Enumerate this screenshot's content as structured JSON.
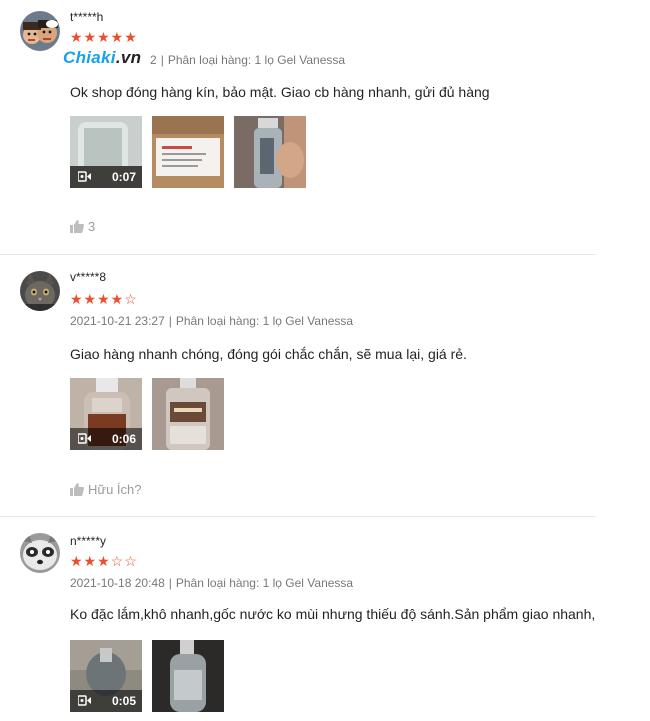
{
  "watermark": {
    "brand": "Chiaki",
    "suffix": ".vn"
  },
  "reviews": [
    {
      "username": "t*****h",
      "rating": 5,
      "stars": "★★★★★",
      "stars_empty": "",
      "date": "2",
      "variation": "Phân loại hàng: 1 lọ Gel Vanessa",
      "comment": "Ok shop đóng hàng kín, bảo mật.  Giao cb hàng nhanh, gửi đủ hàng",
      "media": [
        {
          "type": "video",
          "duration": "0:07"
        },
        {
          "type": "image"
        },
        {
          "type": "image"
        }
      ],
      "likes": "3"
    },
    {
      "username": "v*****8",
      "rating": 4,
      "stars": "★★★★",
      "stars_empty": "☆",
      "date": "2021-10-21 23:27",
      "variation": "Phân loại hàng: 1 lọ Gel Vanessa",
      "comment": "Giao hàng nhanh chóng, đóng gói chắc chắn, sẽ mua lại, giá rẻ.",
      "media": [
        {
          "type": "video",
          "duration": "0:06"
        },
        {
          "type": "image"
        }
      ],
      "likes": "Hữu Ích?"
    },
    {
      "username": "n*****y",
      "rating": 3,
      "stars": "★★★",
      "stars_empty": "☆☆",
      "date": "2021-10-18 20:48",
      "variation": "Phân loại hàng: 1 lọ Gel Vanessa",
      "comment": "Ko đặc lắm,khô nhanh,gốc nước ko mùi nhưng thiếu độ sánh.Sản phẩm giao nhanh,",
      "media": [
        {
          "type": "video",
          "duration": "0:05"
        },
        {
          "type": "image"
        }
      ]
    }
  ],
  "separator": "|",
  "colors": {
    "accent": "#ee4d2d",
    "watermark": "#17a2e8"
  }
}
